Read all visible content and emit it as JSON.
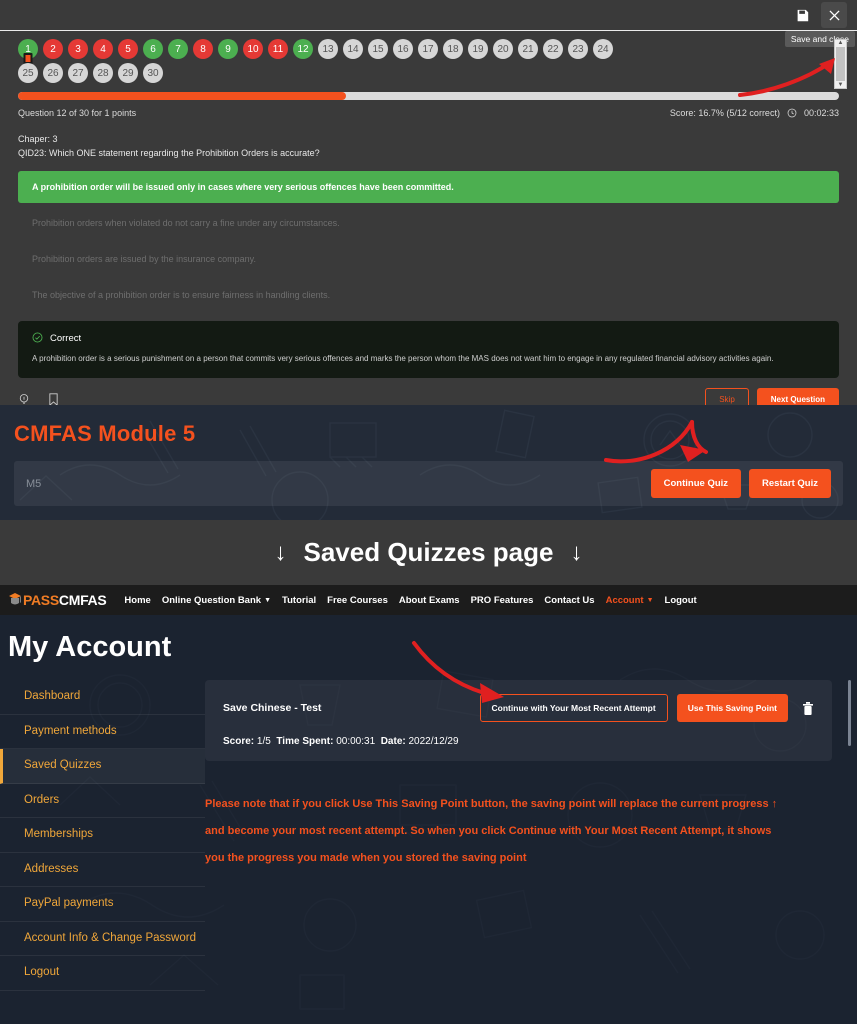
{
  "quiz_modal": {
    "save_icon": "save-disk-icon",
    "close_icon": "close-x-icon",
    "tooltip": "Save and close",
    "bubbles": [
      {
        "n": "1",
        "state": "correct"
      },
      {
        "n": "2",
        "state": "wrong"
      },
      {
        "n": "3",
        "state": "wrong"
      },
      {
        "n": "4",
        "state": "wrong"
      },
      {
        "n": "5",
        "state": "wrong"
      },
      {
        "n": "6",
        "state": "correct"
      },
      {
        "n": "7",
        "state": "correct"
      },
      {
        "n": "8",
        "state": "wrong"
      },
      {
        "n": "9",
        "state": "correct"
      },
      {
        "n": "10",
        "state": "wrong"
      },
      {
        "n": "11",
        "state": "wrong"
      },
      {
        "n": "12",
        "state": "correct"
      },
      {
        "n": "13",
        "state": "unanswered"
      },
      {
        "n": "14",
        "state": "unanswered"
      },
      {
        "n": "15",
        "state": "unanswered"
      },
      {
        "n": "16",
        "state": "unanswered"
      },
      {
        "n": "17",
        "state": "unanswered"
      },
      {
        "n": "18",
        "state": "unanswered"
      },
      {
        "n": "19",
        "state": "unanswered"
      },
      {
        "n": "20",
        "state": "unanswered"
      },
      {
        "n": "21",
        "state": "unanswered"
      },
      {
        "n": "22",
        "state": "unanswered"
      },
      {
        "n": "23",
        "state": "unanswered"
      },
      {
        "n": "24",
        "state": "unanswered"
      },
      {
        "n": "25",
        "state": "unanswered"
      },
      {
        "n": "26",
        "state": "unanswered"
      },
      {
        "n": "27",
        "state": "unanswered"
      },
      {
        "n": "28",
        "state": "unanswered"
      },
      {
        "n": "29",
        "state": "unanswered"
      },
      {
        "n": "30",
        "state": "unanswered"
      }
    ],
    "progress_percent": 40,
    "question_counter": "Question 12 of 30 for 1 points",
    "score_text": "Score: 16.7% (5/12 correct)",
    "timer": "00:02:33",
    "chapter": "Chaper: 3",
    "question": "QID23: Which ONE statement regarding the Prohibition Orders is accurate?",
    "answers": [
      {
        "text": "A prohibition order will be issued only in cases where very serious offences have been committed.",
        "selected": true
      },
      {
        "text": "Prohibition orders when violated do not carry a fine under any circumstances.",
        "selected": false
      },
      {
        "text": "Prohibition orders are issued by the insurance company.",
        "selected": false
      },
      {
        "text": "The objective of a prohibition order is to ensure fairness in handling clients.",
        "selected": false
      }
    ],
    "explanation_title": "Correct",
    "explanation_body": "A prohibition order is a serious punishment on a person that commits very serious offences and marks the person whom the MAS does not want him to engage in any regulated financial advisory activities again.",
    "hint_icon": "lightbulb-icon",
    "bookmark_icon": "bookmark-icon",
    "skip_label": "Skip",
    "next_label": "Next Question"
  },
  "module_banner": {
    "title": "CMFAS Module 5",
    "bar_label": "M5",
    "continue_label": "Continue Quiz",
    "restart_label": "Restart Quiz"
  },
  "divider": {
    "text": "Saved Quizzes page",
    "arrow": "↓"
  },
  "account_page": {
    "logo_pass": "PASS",
    "logo_cmfas": "CMFAS",
    "nav": [
      {
        "label": "Home",
        "caret": false,
        "accent": false
      },
      {
        "label": "Online Question Bank",
        "caret": true,
        "accent": false
      },
      {
        "label": "Tutorial",
        "caret": false,
        "accent": false
      },
      {
        "label": "Free Courses",
        "caret": false,
        "accent": false
      },
      {
        "label": "About Exams",
        "caret": false,
        "accent": false
      },
      {
        "label": "PRO Features",
        "caret": false,
        "accent": false
      },
      {
        "label": "Contact Us",
        "caret": false,
        "accent": false
      },
      {
        "label": "Account",
        "caret": true,
        "accent": true
      },
      {
        "label": "Logout",
        "caret": false,
        "accent": false
      }
    ],
    "page_title": "My Account",
    "sidebar": [
      {
        "label": "Dashboard",
        "active": false
      },
      {
        "label": "Payment methods",
        "active": false
      },
      {
        "label": "Saved Quizzes",
        "active": true
      },
      {
        "label": "Orders",
        "active": false
      },
      {
        "label": "Memberships",
        "active": false
      },
      {
        "label": "Addresses",
        "active": false
      },
      {
        "label": "PayPal payments",
        "active": false
      },
      {
        "label": "Account Info & Change Password",
        "active": false
      },
      {
        "label": "Logout",
        "active": false
      }
    ],
    "saved_quiz": {
      "name": "Save Chinese - Test",
      "continue_label": "Continue with Your Most Recent Attempt",
      "use_label": "Use This Saving Point",
      "delete_icon": "trash-icon",
      "score_label": "Score:",
      "score_value": "1/5",
      "time_label": "Time Spent:",
      "time_value": "00:00:31",
      "date_label": "Date:",
      "date_value": "2022/12/29"
    },
    "note_lines": [
      "Please note that if you click Use This Saving Point button, the saving point will replace the current progress  ↑",
      "and become your most recent attempt. So when you click Continue with Your Most Recent Attempt, it shows",
      "you the progress you made when you stored the saving point"
    ]
  },
  "colors": {
    "accent_orange": "#f4511e",
    "correct_green": "#4caf50",
    "wrong_red": "#e53935",
    "unanswered_gray": "#d6d6d6",
    "sidebar_amber": "#f0a73a",
    "annotation_red": "#e02020",
    "dark_navy": "#1b2330"
  }
}
